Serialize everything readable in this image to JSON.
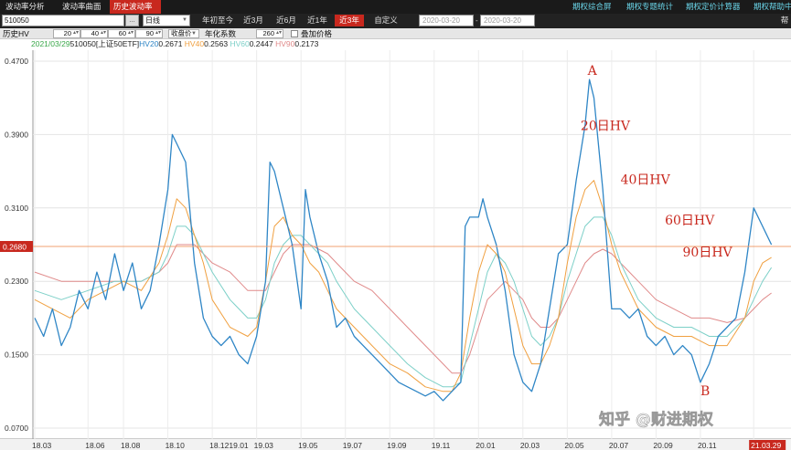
{
  "top_tabs": [
    {
      "label": "波动率分析",
      "active": false
    },
    {
      "label": "波动率曲面",
      "active": false
    },
    {
      "label": "历史波动率",
      "active": true
    }
  ],
  "right_links": [
    "期权综合屏",
    "期权专题统计",
    "期权定价计算器",
    "期权帮助中"
  ],
  "toolbar": {
    "code": "510050",
    "period": "日线",
    "ranges": [
      {
        "label": "年初至今",
        "active": false
      },
      {
        "label": "近3月",
        "active": false
      },
      {
        "label": "近6月",
        "active": false
      },
      {
        "label": "近1年",
        "active": false
      },
      {
        "label": "近3年",
        "active": true
      },
      {
        "label": "自定义",
        "active": false
      }
    ],
    "date_from": "2020-03-20",
    "date_to": "2020-03-20",
    "date_sep": "-",
    "right_label": "帮"
  },
  "params": {
    "label": "历史HV",
    "hv_periods": [
      "20",
      "40",
      "60",
      "90"
    ],
    "price_type": "收盘价",
    "annual_label": "年化系数",
    "annual_value": "260",
    "overlay_label": "叠加价格"
  },
  "legend": {
    "date": "2021/03/29",
    "code": "510050[上证50ETF]",
    "items": [
      {
        "name": "HV20",
        "value": "0.2671",
        "color": "#2f86c6"
      },
      {
        "name": "HV40",
        "value": "0.2563",
        "color": "#f0a040"
      },
      {
        "name": "HV60",
        "value": "0.2447",
        "color": "#7dd0c8"
      },
      {
        "name": "HV90",
        "value": "0.2173",
        "color": "#e08a8a"
      }
    ]
  },
  "chart_data": {
    "type": "line",
    "title": "",
    "xlabel": "",
    "ylabel": "",
    "ylim": [
      0.07,
      0.47
    ],
    "y_ticks": [
      "0.4700",
      "0.3900",
      "0.3100",
      "0.2300",
      "0.1500",
      "0.0700"
    ],
    "y_tick_values": [
      0.47,
      0.39,
      0.31,
      0.23,
      0.15,
      0.07
    ],
    "x_ticks": [
      "18.03",
      "18.06",
      "18.08",
      "18.10",
      "18.1219.01",
      "19.03",
      "19.05",
      "19.07",
      "19.09",
      "19.11",
      "20.01",
      "20.03",
      "20.05",
      "20.07",
      "20.09",
      "20.11",
      "21.03.29"
    ],
    "x_tick_t": [
      0,
      6,
      10,
      15,
      20,
      25,
      30,
      35,
      40,
      45,
      50,
      55,
      60,
      65,
      70,
      75,
      81
    ],
    "x_range": [
      0,
      85
    ],
    "crosshair": {
      "value": 0.268,
      "label": "0.2680"
    },
    "series": [
      {
        "name": "HV20",
        "color": "#2f86c6",
        "width": 1.3,
        "points": [
          [
            0,
            0.19
          ],
          [
            1,
            0.17
          ],
          [
            2,
            0.2
          ],
          [
            3,
            0.16
          ],
          [
            4,
            0.18
          ],
          [
            5,
            0.22
          ],
          [
            6,
            0.2
          ],
          [
            7,
            0.24
          ],
          [
            8,
            0.21
          ],
          [
            9,
            0.26
          ],
          [
            10,
            0.22
          ],
          [
            11,
            0.25
          ],
          [
            12,
            0.2
          ],
          [
            13,
            0.22
          ],
          [
            14,
            0.27
          ],
          [
            15,
            0.33
          ],
          [
            15.5,
            0.39
          ],
          [
            16,
            0.38
          ],
          [
            17,
            0.36
          ],
          [
            18,
            0.25
          ],
          [
            19,
            0.19
          ],
          [
            20,
            0.17
          ],
          [
            21,
            0.16
          ],
          [
            22,
            0.17
          ],
          [
            23,
            0.15
          ],
          [
            24,
            0.14
          ],
          [
            25,
            0.17
          ],
          [
            26,
            0.23
          ],
          [
            26.5,
            0.36
          ],
          [
            27,
            0.35
          ],
          [
            28,
            0.31
          ],
          [
            29,
            0.27
          ],
          [
            30,
            0.2
          ],
          [
            30.5,
            0.33
          ],
          [
            31,
            0.3
          ],
          [
            32,
            0.26
          ],
          [
            33,
            0.23
          ],
          [
            34,
            0.18
          ],
          [
            35,
            0.19
          ],
          [
            36,
            0.17
          ],
          [
            37,
            0.16
          ],
          [
            38,
            0.15
          ],
          [
            39,
            0.14
          ],
          [
            40,
            0.13
          ],
          [
            41,
            0.12
          ],
          [
            42,
            0.115
          ],
          [
            43,
            0.11
          ],
          [
            44,
            0.105
          ],
          [
            45,
            0.11
          ],
          [
            46,
            0.1
          ],
          [
            47,
            0.11
          ],
          [
            48,
            0.12
          ],
          [
            48.5,
            0.29
          ],
          [
            49,
            0.3
          ],
          [
            50,
            0.3
          ],
          [
            50.5,
            0.32
          ],
          [
            51,
            0.3
          ],
          [
            52,
            0.27
          ],
          [
            53,
            0.22
          ],
          [
            54,
            0.15
          ],
          [
            55,
            0.12
          ],
          [
            56,
            0.11
          ],
          [
            57,
            0.14
          ],
          [
            58,
            0.2
          ],
          [
            59,
            0.26
          ],
          [
            60,
            0.27
          ],
          [
            61,
            0.34
          ],
          [
            62,
            0.4
          ],
          [
            62.5,
            0.45
          ],
          [
            63,
            0.43
          ],
          [
            64,
            0.33
          ],
          [
            65,
            0.2
          ],
          [
            66,
            0.2
          ],
          [
            67,
            0.19
          ],
          [
            68,
            0.2
          ],
          [
            69,
            0.17
          ],
          [
            70,
            0.16
          ],
          [
            71,
            0.17
          ],
          [
            72,
            0.15
          ],
          [
            73,
            0.16
          ],
          [
            74,
            0.15
          ],
          [
            75,
            0.12
          ],
          [
            76,
            0.14
          ],
          [
            77,
            0.17
          ],
          [
            78,
            0.18
          ],
          [
            79,
            0.19
          ],
          [
            80,
            0.24
          ],
          [
            81,
            0.31
          ],
          [
            82,
            0.29
          ],
          [
            83,
            0.27
          ]
        ]
      },
      {
        "name": "HV40",
        "color": "#f0a040",
        "width": 1.0,
        "points": [
          [
            0,
            0.21
          ],
          [
            2,
            0.2
          ],
          [
            4,
            0.19
          ],
          [
            6,
            0.21
          ],
          [
            8,
            0.22
          ],
          [
            10,
            0.23
          ],
          [
            12,
            0.22
          ],
          [
            14,
            0.25
          ],
          [
            15,
            0.28
          ],
          [
            16,
            0.32
          ],
          [
            17,
            0.31
          ],
          [
            18,
            0.28
          ],
          [
            19,
            0.25
          ],
          [
            20,
            0.21
          ],
          [
            22,
            0.18
          ],
          [
            24,
            0.17
          ],
          [
            25,
            0.18
          ],
          [
            26,
            0.23
          ],
          [
            27,
            0.29
          ],
          [
            28,
            0.3
          ],
          [
            29,
            0.28
          ],
          [
            30,
            0.27
          ],
          [
            31,
            0.25
          ],
          [
            32,
            0.24
          ],
          [
            33,
            0.22
          ],
          [
            34,
            0.2
          ],
          [
            36,
            0.18
          ],
          [
            38,
            0.16
          ],
          [
            40,
            0.14
          ],
          [
            42,
            0.13
          ],
          [
            44,
            0.115
          ],
          [
            46,
            0.11
          ],
          [
            47,
            0.11
          ],
          [
            48,
            0.13
          ],
          [
            49,
            0.19
          ],
          [
            50,
            0.24
          ],
          [
            51,
            0.27
          ],
          [
            52,
            0.26
          ],
          [
            53,
            0.24
          ],
          [
            54,
            0.2
          ],
          [
            55,
            0.16
          ],
          [
            56,
            0.14
          ],
          [
            57,
            0.14
          ],
          [
            58,
            0.16
          ],
          [
            59,
            0.19
          ],
          [
            60,
            0.25
          ],
          [
            61,
            0.3
          ],
          [
            62,
            0.33
          ],
          [
            63,
            0.34
          ],
          [
            64,
            0.31
          ],
          [
            65,
            0.27
          ],
          [
            66,
            0.24
          ],
          [
            67,
            0.22
          ],
          [
            68,
            0.2
          ],
          [
            70,
            0.18
          ],
          [
            72,
            0.17
          ],
          [
            74,
            0.17
          ],
          [
            76,
            0.16
          ],
          [
            78,
            0.16
          ],
          [
            80,
            0.19
          ],
          [
            81,
            0.23
          ],
          [
            82,
            0.25
          ],
          [
            83,
            0.256
          ]
        ]
      },
      {
        "name": "HV60",
        "color": "#7dd0c8",
        "width": 1.0,
        "points": [
          [
            0,
            0.22
          ],
          [
            3,
            0.21
          ],
          [
            6,
            0.22
          ],
          [
            9,
            0.23
          ],
          [
            12,
            0.23
          ],
          [
            14,
            0.24
          ],
          [
            15,
            0.26
          ],
          [
            16,
            0.29
          ],
          [
            17,
            0.29
          ],
          [
            18,
            0.28
          ],
          [
            19,
            0.26
          ],
          [
            20,
            0.24
          ],
          [
            22,
            0.21
          ],
          [
            24,
            0.19
          ],
          [
            25,
            0.19
          ],
          [
            26,
            0.21
          ],
          [
            27,
            0.25
          ],
          [
            28,
            0.27
          ],
          [
            29,
            0.28
          ],
          [
            30,
            0.28
          ],
          [
            31,
            0.27
          ],
          [
            32,
            0.26
          ],
          [
            33,
            0.25
          ],
          [
            34,
            0.23
          ],
          [
            36,
            0.2
          ],
          [
            38,
            0.18
          ],
          [
            40,
            0.16
          ],
          [
            42,
            0.14
          ],
          [
            44,
            0.125
          ],
          [
            46,
            0.115
          ],
          [
            47,
            0.115
          ],
          [
            48,
            0.12
          ],
          [
            49,
            0.16
          ],
          [
            50,
            0.2
          ],
          [
            51,
            0.24
          ],
          [
            52,
            0.26
          ],
          [
            53,
            0.25
          ],
          [
            54,
            0.23
          ],
          [
            55,
            0.2
          ],
          [
            56,
            0.17
          ],
          [
            57,
            0.16
          ],
          [
            58,
            0.17
          ],
          [
            59,
            0.19
          ],
          [
            60,
            0.23
          ],
          [
            61,
            0.26
          ],
          [
            62,
            0.29
          ],
          [
            63,
            0.3
          ],
          [
            64,
            0.3
          ],
          [
            65,
            0.28
          ],
          [
            66,
            0.25
          ],
          [
            67,
            0.23
          ],
          [
            68,
            0.21
          ],
          [
            70,
            0.19
          ],
          [
            72,
            0.18
          ],
          [
            74,
            0.18
          ],
          [
            76,
            0.17
          ],
          [
            78,
            0.17
          ],
          [
            80,
            0.19
          ],
          [
            81,
            0.21
          ],
          [
            82,
            0.23
          ],
          [
            83,
            0.245
          ]
        ]
      },
      {
        "name": "HV90",
        "color": "#e08a8a",
        "width": 1.0,
        "points": [
          [
            0,
            0.24
          ],
          [
            3,
            0.23
          ],
          [
            6,
            0.23
          ],
          [
            9,
            0.23
          ],
          [
            12,
            0.23
          ],
          [
            14,
            0.24
          ],
          [
            15,
            0.25
          ],
          [
            16,
            0.27
          ],
          [
            17,
            0.27
          ],
          [
            18,
            0.27
          ],
          [
            19,
            0.26
          ],
          [
            20,
            0.25
          ],
          [
            22,
            0.24
          ],
          [
            24,
            0.22
          ],
          [
            25,
            0.22
          ],
          [
            26,
            0.22
          ],
          [
            27,
            0.24
          ],
          [
            28,
            0.26
          ],
          [
            29,
            0.27
          ],
          [
            30,
            0.27
          ],
          [
            31,
            0.27
          ],
          [
            32,
            0.265
          ],
          [
            33,
            0.26
          ],
          [
            34,
            0.25
          ],
          [
            36,
            0.23
          ],
          [
            38,
            0.22
          ],
          [
            40,
            0.2
          ],
          [
            42,
            0.18
          ],
          [
            44,
            0.16
          ],
          [
            46,
            0.14
          ],
          [
            47,
            0.13
          ],
          [
            48,
            0.13
          ],
          [
            49,
            0.15
          ],
          [
            50,
            0.18
          ],
          [
            51,
            0.21
          ],
          [
            52,
            0.22
          ],
          [
            53,
            0.23
          ],
          [
            54,
            0.22
          ],
          [
            55,
            0.21
          ],
          [
            56,
            0.19
          ],
          [
            57,
            0.18
          ],
          [
            58,
            0.18
          ],
          [
            59,
            0.19
          ],
          [
            60,
            0.21
          ],
          [
            61,
            0.23
          ],
          [
            62,
            0.25
          ],
          [
            63,
            0.26
          ],
          [
            64,
            0.265
          ],
          [
            65,
            0.26
          ],
          [
            66,
            0.25
          ],
          [
            67,
            0.24
          ],
          [
            68,
            0.23
          ],
          [
            70,
            0.21
          ],
          [
            72,
            0.2
          ],
          [
            74,
            0.19
          ],
          [
            76,
            0.19
          ],
          [
            78,
            0.185
          ],
          [
            80,
            0.19
          ],
          [
            81,
            0.2
          ],
          [
            82,
            0.21
          ],
          [
            83,
            0.2173
          ]
        ]
      }
    ],
    "annotations": [
      {
        "text": "A",
        "x": 62.3,
        "y": 0.455
      },
      {
        "text": "20日HV",
        "x": 61.5,
        "y": 0.395
      },
      {
        "text": "40日HV",
        "x": 66.0,
        "y": 0.336
      },
      {
        "text": "60日HV",
        "x": 71.0,
        "y": 0.292
      },
      {
        "text": "90日HV",
        "x": 73.0,
        "y": 0.257
      },
      {
        "text": "B",
        "x": 75.0,
        "y": 0.106
      }
    ],
    "annotation_color": "#c8281e",
    "watermark": "知乎 @财进期权"
  }
}
